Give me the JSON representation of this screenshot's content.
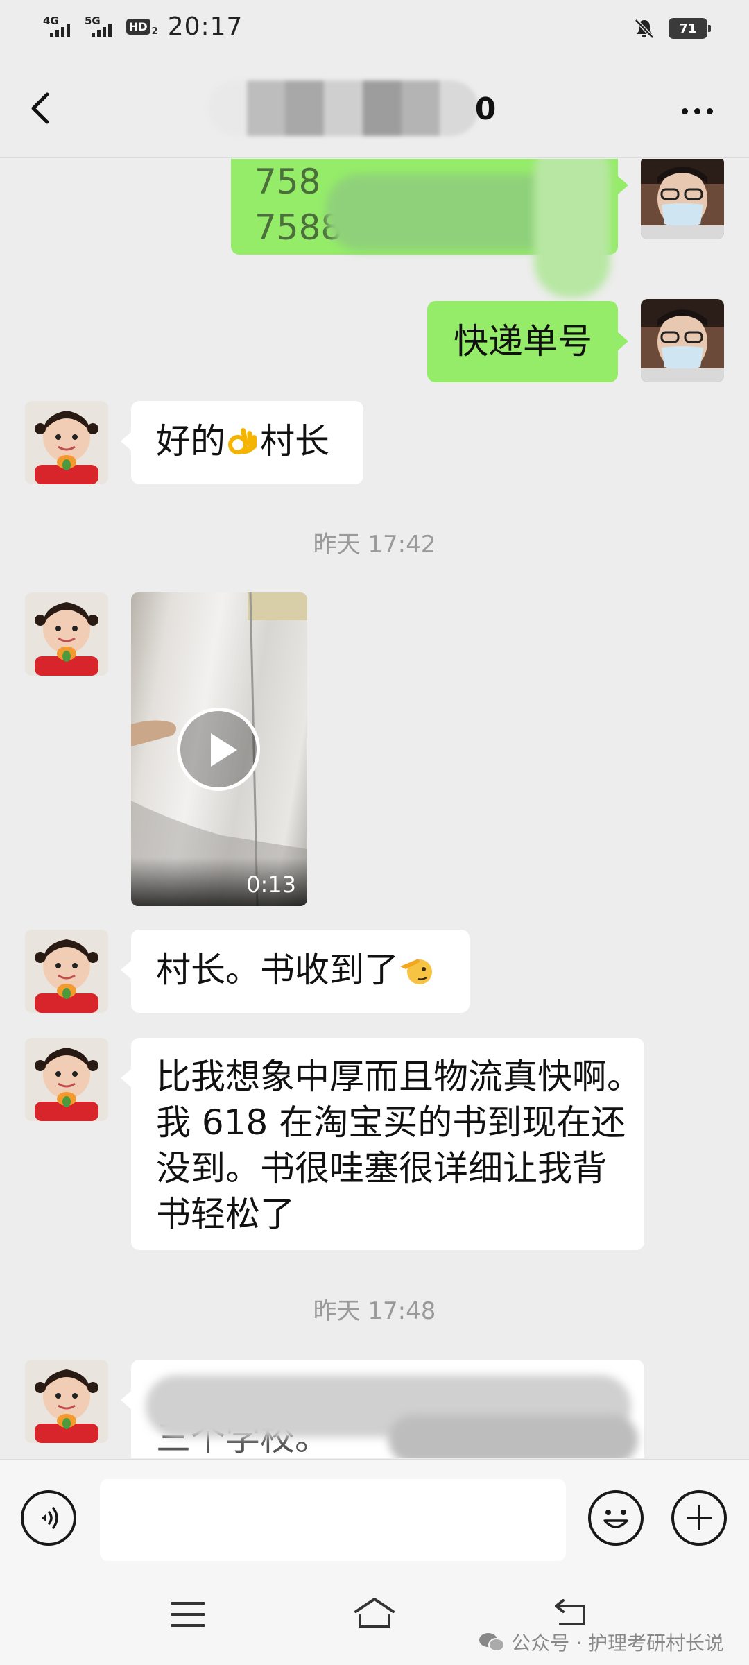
{
  "status_bar": {
    "sim1": "4G",
    "sim2": "5G",
    "hd": "HD",
    "hd_sub": "2",
    "time": "20:17",
    "battery": "71"
  },
  "header": {
    "title": "0",
    "back_icon": "chevron-left-icon",
    "more_icon": "more-dots-icon"
  },
  "messages": {
    "m1": {
      "line1": "758",
      "line2": "7588"
    },
    "m2": {
      "text": "快递单号"
    },
    "m3": {
      "text_before": "好的",
      "emoji": "ok-hand-emoji",
      "text_after": "村长"
    },
    "ts1": "昨天 17:42",
    "video": {
      "duration": "0:13"
    },
    "m4": {
      "text": "村长。书收到了",
      "emoji": "saluting-face-emoji"
    },
    "m5": {
      "line1": "比我想象中厚而且物流真快啊。",
      "line2": "我 618 在淘宝买的书到现在还",
      "line3": "没到。书很哇塞很详细让我背",
      "line4": "书轻松了"
    },
    "ts2": "昨天 17:48",
    "m6": {
      "text": "三个学校。"
    }
  },
  "input_bar": {
    "voice_icon": "voice-icon",
    "emoji_icon": "smiley-icon",
    "plus_icon": "plus-icon",
    "placeholder": ""
  },
  "system_nav": {
    "menu_icon": "menu-icon",
    "home_icon": "home-icon",
    "back_icon": "back-icon"
  },
  "watermark": {
    "text": "公众号 · 护理考研村长说"
  },
  "colors": {
    "background": "#ededed",
    "sent_bubble": "#95ec69",
    "received_bubble": "#ffffff",
    "timestamp": "#9a9a9a"
  }
}
